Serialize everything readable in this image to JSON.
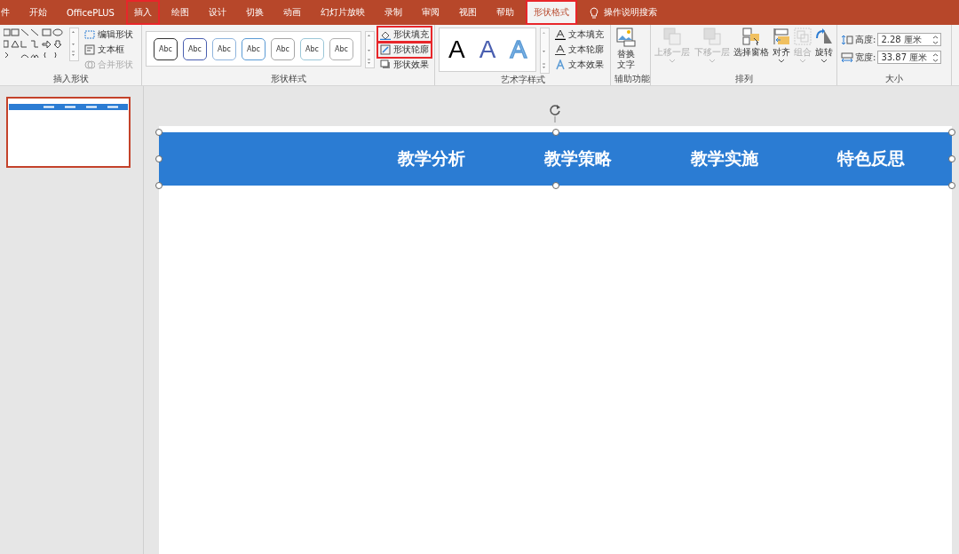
{
  "tabs": [
    {
      "label": "件",
      "selected": false,
      "highlighted": false
    },
    {
      "label": "开始",
      "selected": false,
      "highlighted": false
    },
    {
      "label": "OfficePLUS",
      "selected": false,
      "highlighted": false
    },
    {
      "label": "插入",
      "selected": false,
      "highlighted": true
    },
    {
      "label": "绘图",
      "selected": false,
      "highlighted": false
    },
    {
      "label": "设计",
      "selected": false,
      "highlighted": false
    },
    {
      "label": "切换",
      "selected": false,
      "highlighted": false
    },
    {
      "label": "动画",
      "selected": false,
      "highlighted": false
    },
    {
      "label": "幻灯片放映",
      "selected": false,
      "highlighted": false
    },
    {
      "label": "录制",
      "selected": false,
      "highlighted": false
    },
    {
      "label": "审阅",
      "selected": false,
      "highlighted": false
    },
    {
      "label": "视图",
      "selected": false,
      "highlighted": false
    },
    {
      "label": "帮助",
      "selected": false,
      "highlighted": false
    },
    {
      "label": "形状格式",
      "selected": true,
      "highlighted": true
    }
  ],
  "tell_me": {
    "label": "操作说明搜索"
  },
  "ribbon": {
    "insert_shapes": {
      "label": "插入形状",
      "commands": [
        {
          "label": "编辑形状",
          "disabled": false
        },
        {
          "label": "文本框",
          "disabled": false
        },
        {
          "label": "合并形状",
          "disabled": true
        }
      ]
    },
    "shape_styles": {
      "label": "形状样式",
      "presets": [
        {
          "label": "Abc",
          "color": "#333333"
        },
        {
          "label": "Abc",
          "color": "#4a5fb0"
        },
        {
          "label": "Abc",
          "color": "#8fb4dd"
        },
        {
          "label": "Abc",
          "color": "#5b9bd5"
        },
        {
          "label": "Abc",
          "color": "#a6a6a6"
        },
        {
          "label": "Abc",
          "color": "#9cc7d8"
        },
        {
          "label": "Abc",
          "color": "#b0b0b0"
        }
      ],
      "commands": [
        {
          "label": "形状填充",
          "highlighted": true
        },
        {
          "label": "形状轮廓",
          "highlighted": true
        },
        {
          "label": "形状效果",
          "highlighted": false
        }
      ]
    },
    "wordart_styles": {
      "label": "艺术字样式",
      "presets": [
        {
          "label": "A",
          "kind": "solid",
          "color": "#000000"
        },
        {
          "label": "A",
          "kind": "solid",
          "color": "#4a5fb0"
        },
        {
          "label": "A",
          "kind": "outline",
          "color": "#8cbcec"
        }
      ],
      "commands": [
        {
          "label": "文本填充"
        },
        {
          "label": "文本轮廓"
        },
        {
          "label": "文本效果"
        }
      ]
    },
    "accessibility": {
      "label": "辅助功能",
      "button": {
        "label": "替换文字"
      }
    },
    "arrange": {
      "label": "排列",
      "commands": [
        {
          "label": "上移一层",
          "disabled": true
        },
        {
          "label": "下移一层",
          "disabled": true
        },
        {
          "label": "选择窗格",
          "disabled": false
        },
        {
          "label": "对齐",
          "disabled": false
        },
        {
          "label": "组合",
          "disabled": true
        },
        {
          "label": "旋转",
          "disabled": false
        }
      ]
    },
    "size": {
      "label": "大小",
      "fields": [
        {
          "label": "高度:",
          "value": "2.28 厘米"
        },
        {
          "label": "宽度:",
          "value": "33.87 厘米"
        }
      ]
    }
  },
  "thumbnails": [
    {
      "selected": true
    }
  ],
  "slide": {
    "header_selected": true,
    "header_items": [
      "教学分析",
      "教学策略",
      "教学实施",
      "特色反思"
    ]
  }
}
